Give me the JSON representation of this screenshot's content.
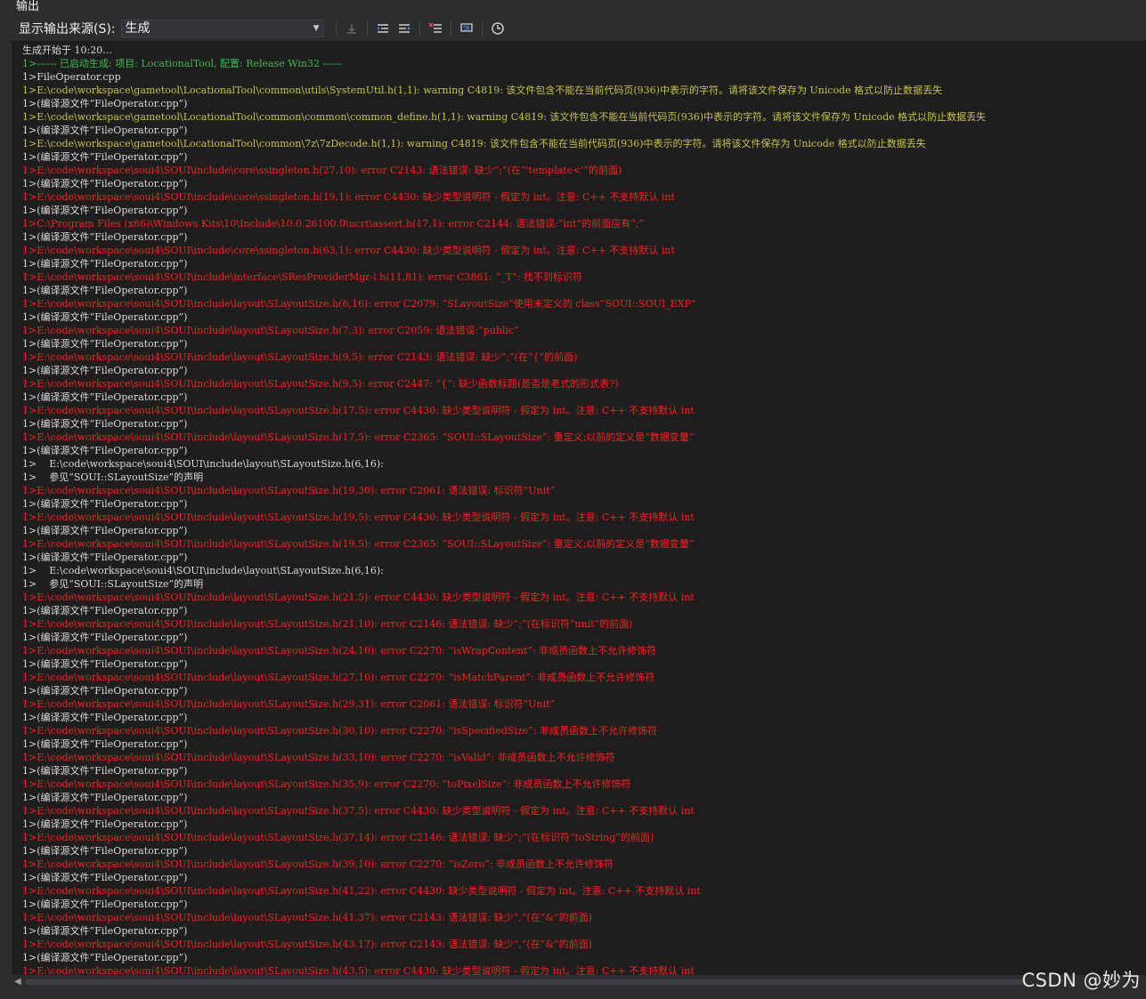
{
  "panel": {
    "title": "输出"
  },
  "toolbar": {
    "source_label": "显示输出来源(S):",
    "source_value": "生成"
  },
  "output_lines": [
    {
      "text": "生成开始于 10:20...",
      "level": "normal"
    },
    {
      "text": "1>------ 已启动生成: 项目: LocationalTool, 配置: Release Win32 ------",
      "level": "status"
    },
    {
      "text": "1>FileOperator.cpp",
      "level": "normal"
    },
    {
      "text": "1>E:\\code\\workspace\\gametool\\LocationalTool\\common\\utils\\SystemUtil.h(1,1): warning C4819: 该文件包含不能在当前代码页(936)中表示的字符。请将该文件保存为 Unicode 格式以防止数据丢失",
      "level": "warning"
    },
    {
      "text": "1>(编译源文件“FileOperator.cpp”)",
      "level": "normal"
    },
    {
      "text": "1>E:\\code\\workspace\\gametool\\LocationalTool\\common\\common\\common_define.h(1,1): warning C4819: 该文件包含不能在当前代码页(936)中表示的字符。请将该文件保存为 Unicode 格式以防止数据丢失",
      "level": "warning"
    },
    {
      "text": "1>(编译源文件“FileOperator.cpp”)",
      "level": "normal"
    },
    {
      "text": "1>E:\\code\\workspace\\gametool\\LocationalTool\\common\\7z\\7zDecode.h(1,1): warning C4819: 该文件包含不能在当前代码页(936)中表示的字符。请将该文件保存为 Unicode 格式以防止数据丢失",
      "level": "warning"
    },
    {
      "text": "1>(编译源文件“FileOperator.cpp”)",
      "level": "normal"
    },
    {
      "text": "1>E:\\code\\workspace\\soui4\\SOUI\\include\\core\\ssingleton.h(27,10): error C2143: 语法错误: 缺少“;”(在“'template<'”的前面)",
      "level": "error"
    },
    {
      "text": "1>(编译源文件“FileOperator.cpp”)",
      "level": "normal"
    },
    {
      "text": "1>E:\\code\\workspace\\soui4\\SOUI\\include\\core\\ssingleton.h(19,1): error C4430: 缺少类型说明符 - 假定为 int。注意: C++ 不支持默认 int",
      "level": "error"
    },
    {
      "text": "1>(编译源文件“FileOperator.cpp”)",
      "level": "normal"
    },
    {
      "text": "1>C:\\Program Files (x86)\\Windows Kits\\10\\Include\\10.0.26100.0\\ucrt\\assert.h(17,1): error C2144: 语法错误:“int”的前面应有“;”",
      "level": "error"
    },
    {
      "text": "1>(编译源文件“FileOperator.cpp”)",
      "level": "normal"
    },
    {
      "text": "1>E:\\code\\workspace\\soui4\\SOUI\\include\\core\\ssingleton.h(63,1): error C4430: 缺少类型说明符 - 假定为 int。注意: C++ 不支持默认 int",
      "level": "error"
    },
    {
      "text": "1>(编译源文件“FileOperator.cpp”)",
      "level": "normal"
    },
    {
      "text": "1>E:\\code\\workspace\\soui4\\SOUI\\include\\interface\\SResProviderMgr-i.h(11,81): error C3861: “_T”: 找不到标识符",
      "level": "error"
    },
    {
      "text": "1>(编译源文件“FileOperator.cpp”)",
      "level": "normal"
    },
    {
      "text": "1>E:\\code\\workspace\\soui4\\SOUI\\include\\layout\\SLayoutSize.h(6,16): error C2079: “SLayoutSize”使用未定义的 class“SOUI::SOUI_EXP”",
      "level": "error"
    },
    {
      "text": "1>(编译源文件“FileOperator.cpp”)",
      "level": "normal"
    },
    {
      "text": "1>E:\\code\\workspace\\soui4\\SOUI\\include\\layout\\SLayoutSize.h(7,3): error C2059: 语法错误:“public”",
      "level": "error"
    },
    {
      "text": "1>(编译源文件“FileOperator.cpp”)",
      "level": "normal"
    },
    {
      "text": "1>E:\\code\\workspace\\soui4\\SOUI\\include\\layout\\SLayoutSize.h(9,5): error C2143: 语法错误: 缺少“;”(在“{”的前面)",
      "level": "error"
    },
    {
      "text": "1>(编译源文件“FileOperator.cpp”)",
      "level": "normal"
    },
    {
      "text": "1>E:\\code\\workspace\\soui4\\SOUI\\include\\layout\\SLayoutSize.h(9,5): error C2447: “{”: 缺少函数标题(是否是老式的形式表?)",
      "level": "error"
    },
    {
      "text": "1>(编译源文件“FileOperator.cpp”)",
      "level": "normal"
    },
    {
      "text": "1>E:\\code\\workspace\\soui4\\SOUI\\include\\layout\\SLayoutSize.h(17,5): error C4430: 缺少类型说明符 - 假定为 int。注意: C++ 不支持默认 int",
      "level": "error"
    },
    {
      "text": "1>(编译源文件“FileOperator.cpp”)",
      "level": "normal"
    },
    {
      "text": "1>E:\\code\\workspace\\soui4\\SOUI\\include\\layout\\SLayoutSize.h(17,5): error C2365: “SOUI::SLayoutSize”: 重定义;以前的定义是“数据变量”",
      "level": "error"
    },
    {
      "text": "1>(编译源文件“FileOperator.cpp”)",
      "level": "normal"
    },
    {
      "text": "1>    E:\\code\\workspace\\soui4\\SOUI\\include\\layout\\SLayoutSize.h(6,16):",
      "level": "normal"
    },
    {
      "text": "1>    参见“SOUI::SLayoutSize”的声明",
      "level": "normal"
    },
    {
      "text": "1>E:\\code\\workspace\\soui4\\SOUI\\include\\layout\\SLayoutSize.h(19,30): error C2061: 语法错误: 标识符“Unit”",
      "level": "error"
    },
    {
      "text": "1>(编译源文件“FileOperator.cpp”)",
      "level": "normal"
    },
    {
      "text": "1>E:\\code\\workspace\\soui4\\SOUI\\include\\layout\\SLayoutSize.h(19,5): error C4430: 缺少类型说明符 - 假定为 int。注意: C++ 不支持默认 int",
      "level": "error"
    },
    {
      "text": "1>(编译源文件“FileOperator.cpp”)",
      "level": "normal"
    },
    {
      "text": "1>E:\\code\\workspace\\soui4\\SOUI\\include\\layout\\SLayoutSize.h(19,5): error C2365: “SOUI::SLayoutSize”: 重定义;以前的定义是“数据变量”",
      "level": "error"
    },
    {
      "text": "1>(编译源文件“FileOperator.cpp”)",
      "level": "normal"
    },
    {
      "text": "1>    E:\\code\\workspace\\soui4\\SOUI\\include\\layout\\SLayoutSize.h(6,16):",
      "level": "normal"
    },
    {
      "text": "1>    参见“SOUI::SLayoutSize”的声明",
      "level": "normal"
    },
    {
      "text": "1>E:\\code\\workspace\\soui4\\SOUI\\include\\layout\\SLayoutSize.h(21,5): error C4430: 缺少类型说明符 - 假定为 int。注意: C++ 不支持默认 int",
      "level": "error"
    },
    {
      "text": "1>(编译源文件“FileOperator.cpp”)",
      "level": "normal"
    },
    {
      "text": "1>E:\\code\\workspace\\soui4\\SOUI\\include\\layout\\SLayoutSize.h(21,10): error C2146: 语法错误: 缺少“;”(在标识符“unit”的前面)",
      "level": "error"
    },
    {
      "text": "1>(编译源文件“FileOperator.cpp”)",
      "level": "normal"
    },
    {
      "text": "1>E:\\code\\workspace\\soui4\\SOUI\\include\\layout\\SLayoutSize.h(24,10): error C2270: “isWrapContent”: 非成员函数上不允许修饰符",
      "level": "error"
    },
    {
      "text": "1>(编译源文件“FileOperator.cpp”)",
      "level": "normal"
    },
    {
      "text": "1>E:\\code\\workspace\\soui4\\SOUI\\include\\layout\\SLayoutSize.h(27,10): error C2270: “isMatchParent”: 非成员函数上不允许修饰符",
      "level": "error"
    },
    {
      "text": "1>(编译源文件“FileOperator.cpp”)",
      "level": "normal"
    },
    {
      "text": "1>E:\\code\\workspace\\soui4\\SOUI\\include\\layout\\SLayoutSize.h(29,31): error C2061: 语法错误: 标识符“Unit”",
      "level": "error"
    },
    {
      "text": "1>(编译源文件“FileOperator.cpp”)",
      "level": "normal"
    },
    {
      "text": "1>E:\\code\\workspace\\soui4\\SOUI\\include\\layout\\SLayoutSize.h(30,10): error C2270: “isSpecifiedSize”: 非成员函数上不允许修饰符",
      "level": "error"
    },
    {
      "text": "1>(编译源文件“FileOperator.cpp”)",
      "level": "normal"
    },
    {
      "text": "1>E:\\code\\workspace\\soui4\\SOUI\\include\\layout\\SLayoutSize.h(33,10): error C2270: “isValid”: 非成员函数上不允许修饰符",
      "level": "error"
    },
    {
      "text": "1>(编译源文件“FileOperator.cpp”)",
      "level": "normal"
    },
    {
      "text": "1>E:\\code\\workspace\\soui4\\SOUI\\include\\layout\\SLayoutSize.h(35,9): error C2270: “toPixelSize”: 非成员函数上不允许修饰符",
      "level": "error"
    },
    {
      "text": "1>(编译源文件“FileOperator.cpp”)",
      "level": "normal"
    },
    {
      "text": "1>E:\\code\\workspace\\soui4\\SOUI\\include\\layout\\SLayoutSize.h(37,5): error C4430: 缺少类型说明符 - 假定为 int。注意: C++ 不支持默认 int",
      "level": "error"
    },
    {
      "text": "1>(编译源文件“FileOperator.cpp”)",
      "level": "normal"
    },
    {
      "text": "1>E:\\code\\workspace\\soui4\\SOUI\\include\\layout\\SLayoutSize.h(37,14): error C2146: 语法错误: 缺少“;”(在标识符“toString”的前面)",
      "level": "error"
    },
    {
      "text": "1>(编译源文件“FileOperator.cpp”)",
      "level": "normal"
    },
    {
      "text": "1>E:\\code\\workspace\\soui4\\SOUI\\include\\layout\\SLayoutSize.h(39,10): error C2270: “isZero”: 非成员函数上不允许修饰符",
      "level": "error"
    },
    {
      "text": "1>(编译源文件“FileOperator.cpp”)",
      "level": "normal"
    },
    {
      "text": "1>E:\\code\\workspace\\soui4\\SOUI\\include\\layout\\SLayoutSize.h(41,22): error C4430: 缺少类型说明符 - 假定为 int。注意: C++ 不支持默认 int",
      "level": "error"
    },
    {
      "text": "1>(编译源文件“FileOperator.cpp”)",
      "level": "normal"
    },
    {
      "text": "1>E:\\code\\workspace\\soui4\\SOUI\\include\\layout\\SLayoutSize.h(41,37): error C2143: 语法错误: 缺少“,”(在“&”的前面)",
      "level": "error"
    },
    {
      "text": "1>(编译源文件“FileOperator.cpp”)",
      "level": "normal"
    },
    {
      "text": "1>E:\\code\\workspace\\soui4\\SOUI\\include\\layout\\SLayoutSize.h(43,17): error C2143: 语法错误: 缺少“,”(在“&”的前面)",
      "level": "error"
    },
    {
      "text": "1>(编译源文件“FileOperator.cpp”)",
      "level": "normal"
    },
    {
      "text": "1>E:\\code\\workspace\\soui4\\SOUI\\include\\layout\\SLayoutSize.h(43,5): error C4430: 缺少类型说明符 - 假定为 int。注意: C++ 不支持默认 int",
      "level": "error"
    }
  ],
  "watermark": "CSDN @妙为",
  "colors": {
    "error": "#ff1f1f",
    "warning": "#c8c43f",
    "status": "#3fb950",
    "normal": "#dadada",
    "background": "#1e1e1e"
  }
}
